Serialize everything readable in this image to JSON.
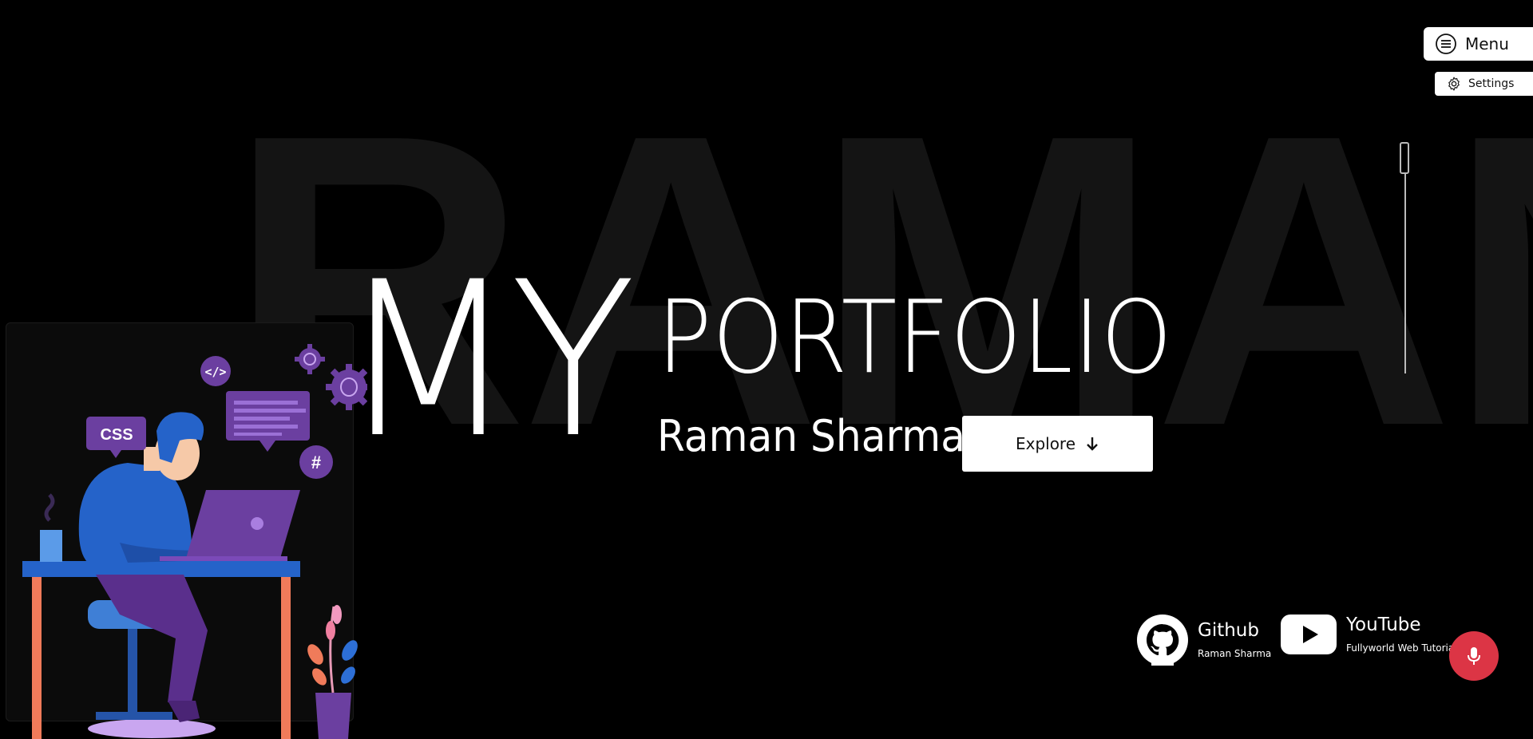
{
  "background_name": "RAMAN",
  "menu": {
    "label": "Menu",
    "icon": "hamburger-circle-icon"
  },
  "settings": {
    "label": "Settings",
    "icon": "gear-icon"
  },
  "hero": {
    "my": "MY",
    "portfolio": "PORTFOLIO",
    "name": "Raman Sharma",
    "explore_label": "Explore",
    "explore_icon": "arrow-down-icon"
  },
  "illustration": {
    "css_badge": "CSS",
    "code_badge": "</>",
    "hash_badge": "#"
  },
  "social": {
    "github": {
      "title": "Github",
      "subtitle": "Raman Sharma",
      "icon": "github-icon"
    },
    "youtube": {
      "title": "YouTube",
      "subtitle": "Fullyworld Web Tutorials",
      "icon": "youtube-icon"
    }
  },
  "mic": {
    "icon": "microphone-icon"
  },
  "colors": {
    "background": "#000000",
    "accent_purple": "#6b3fa0",
    "accent_blue": "#2a63c7",
    "mic_red": "#dc3545"
  }
}
